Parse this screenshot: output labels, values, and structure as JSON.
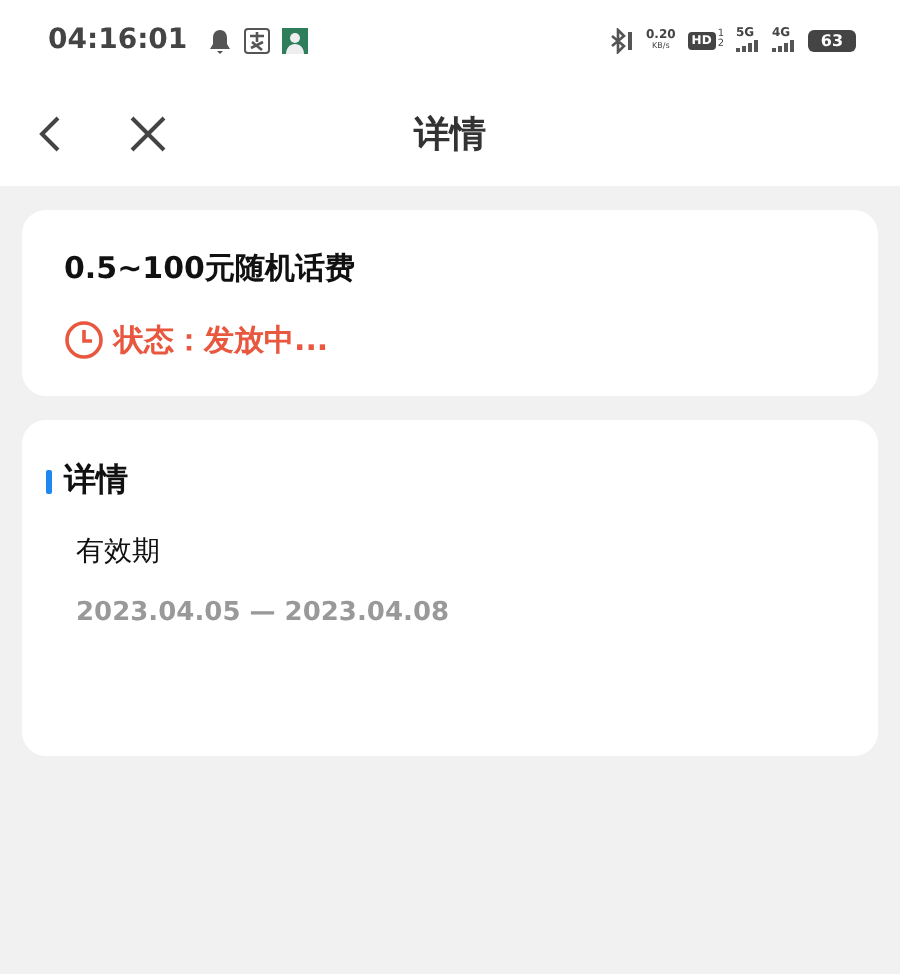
{
  "status_bar": {
    "time": "04:16:01",
    "net_speed": "0.20",
    "net_unit": "KB/s",
    "hd": "HD",
    "hd_slots": [
      "1",
      "2"
    ],
    "networks": [
      "5G",
      "4G"
    ],
    "battery": "63"
  },
  "nav": {
    "title": "详情"
  },
  "summary": {
    "title": "0.5~100元随机话费",
    "status": "状态：发放中..."
  },
  "details": {
    "heading": "详情",
    "label": "有效期",
    "value": "2023.04.05 — 2023.04.08"
  }
}
